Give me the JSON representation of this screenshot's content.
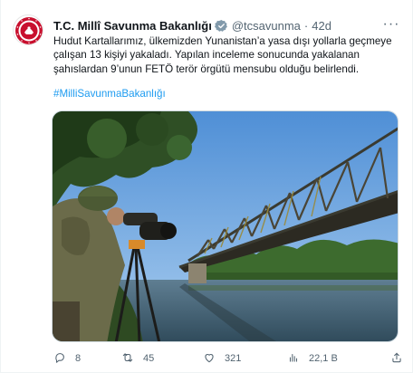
{
  "tweet": {
    "author_name": "T.C. Millî Savunma Bakanlığı",
    "handle": "@tcsavunma",
    "separator": "·",
    "time": "42d",
    "more_label": "···",
    "text": "Hudut Kartallarımız, ülkemizden Yunanistan’a yasa dışı yollarla geçmeye çalışan 13 kişiyi yakaladı. Yapılan inceleme sonucunda yakalanan şahıslardan 9’unun FETÖ terör örgütü mensubu olduğu belirlendi.",
    "hashtag": "#MilliSavunmaBakanlığı"
  },
  "actions": {
    "replies": "8",
    "retweets": "45",
    "likes": "321",
    "views": "22,1 B"
  },
  "icons": {
    "verified": "verified-badge-icon",
    "reply": "reply-icon",
    "retweet": "retweet-icon",
    "like": "heart-icon",
    "views": "views-chart-icon",
    "share": "share-icon",
    "more": "more-icon"
  },
  "colors": {
    "accent": "#1d9bf0",
    "secondary_text": "#536471",
    "text": "#0f1419"
  }
}
